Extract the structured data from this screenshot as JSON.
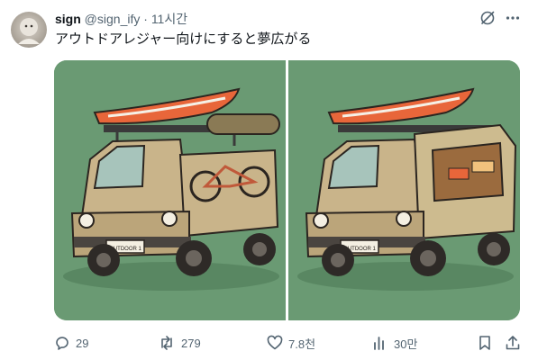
{
  "author": {
    "display_name": "sign",
    "handle": "@sign_ify",
    "separator": "·",
    "time": "11시간"
  },
  "tweet": {
    "text": "アウトドアレジャー向けにすると夢広がる"
  },
  "media": {
    "left_plate": "OUTDOOR 1",
    "right_plate": "OUTDOOR 1"
  },
  "stats": {
    "replies": "29",
    "reposts": "279",
    "likes": "7.8천",
    "views": "30만"
  },
  "icons": {
    "top_right": [
      "grok-icon",
      "more-icon"
    ],
    "actions": [
      "reply-icon",
      "repost-icon",
      "like-icon",
      "views-icon",
      "bookmark-icon",
      "share-icon"
    ]
  },
  "colors": {
    "background": "#ffffff",
    "text_primary": "#0f1419",
    "text_secondary": "#536471",
    "media_green": "#6a9a73",
    "van_tan": "#c9b48a",
    "kayak_orange": "#e8663a"
  }
}
